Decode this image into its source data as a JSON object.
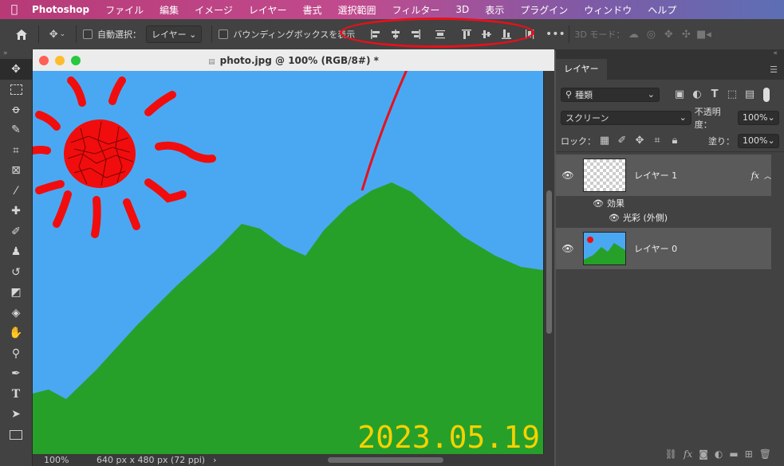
{
  "menubar": {
    "app_name": "Photoshop",
    "items": [
      "ファイル",
      "編集",
      "イメージ",
      "レイヤー",
      "書式",
      "選択範囲",
      "フィルター",
      "3D",
      "表示",
      "プラグイン",
      "ウィンドウ",
      "ヘルプ"
    ]
  },
  "options": {
    "auto_select_label": "自動選択：",
    "auto_select_value": "レイヤー",
    "bounding_box_label": "バウンディングボックスを表示",
    "mode_3d_label": "3D モード："
  },
  "document": {
    "title": "photo.jpg @ 100% (RGB/8#) *",
    "zoom": "100%",
    "info": "640 px x 480 px (72 ppi)",
    "date_text": "2023.05.19"
  },
  "layers_panel": {
    "tab": "レイヤー",
    "filter_kind": "種類",
    "blend_mode": "スクリーン",
    "opacity_label": "不透明度：",
    "opacity_value": "100%",
    "lock_label": "ロック：",
    "fill_label": "塗り：",
    "fill_value": "100%",
    "layers": [
      {
        "name": "レイヤー 1",
        "fx": "fx"
      },
      {
        "name": "レイヤー 0"
      }
    ],
    "effects_label": "効果",
    "effect_item": "光彩 (外側)"
  },
  "colors": {
    "sky": "#4aa8f2",
    "mountain": "#27a02a",
    "sun": "#f10d0d",
    "date_text": "#f6d200",
    "annotation": "#e8101a"
  }
}
